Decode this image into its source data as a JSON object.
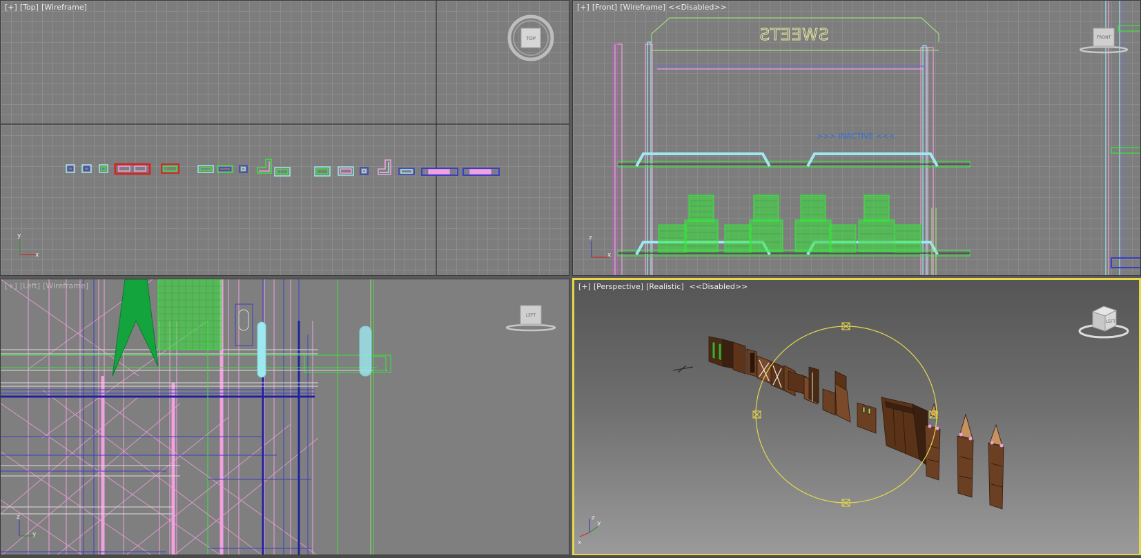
{
  "viewports": {
    "top": {
      "labels": [
        "[+]",
        "[Top]",
        "[Wireframe]"
      ],
      "cube_label": "TOP"
    },
    "front": {
      "labels": [
        "[+]",
        "[Front]",
        "[Wireframe]",
        "<<Disabled>>"
      ],
      "cube_label": "FRONT",
      "sign_text": "SWEETS",
      "inactive_text": ">>> INACTIVE <<<"
    },
    "left": {
      "labels": [
        "[+]",
        "[Left]",
        "[Wireframe]"
      ],
      "cube_label": "LEFT"
    },
    "perspective": {
      "labels": [
        "[+]",
        "[Perspective]",
        "[Realistic]",
        "<<Disabled>>"
      ],
      "cube_label": "LEFT",
      "active_border_color": "#e6d84a"
    }
  },
  "axis": {
    "x": "x",
    "y": "y",
    "z": "z"
  },
  "colors": {
    "selection": "#e6d84a",
    "wire_green": "#35e83a",
    "wire_pink": "#f2a0e0",
    "wire_blue": "#3c3cc8",
    "wire_cyan": "#9ee8f0",
    "wire_red": "#d02828",
    "furniture_brown": "#6b3f22"
  }
}
